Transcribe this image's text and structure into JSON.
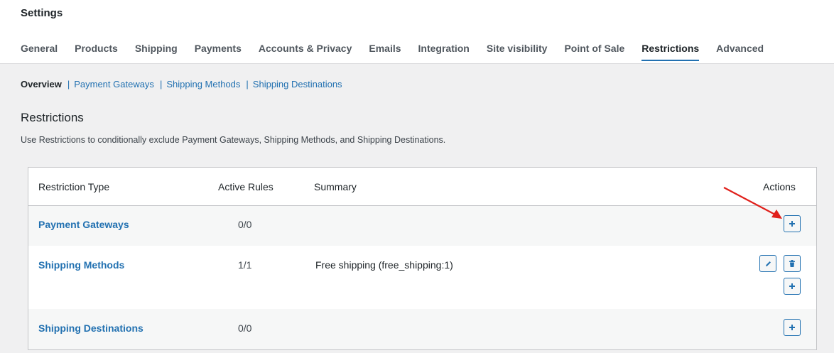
{
  "header": {
    "title": "Settings"
  },
  "tabs": [
    {
      "label": "General"
    },
    {
      "label": "Products"
    },
    {
      "label": "Shipping"
    },
    {
      "label": "Payments"
    },
    {
      "label": "Accounts & Privacy"
    },
    {
      "label": "Emails"
    },
    {
      "label": "Integration"
    },
    {
      "label": "Site visibility"
    },
    {
      "label": "Point of Sale"
    },
    {
      "label": "Restrictions",
      "active": true
    },
    {
      "label": "Advanced"
    }
  ],
  "subnav": {
    "current": "Overview",
    "separator": "|",
    "links": [
      "Payment Gateways",
      "Shipping Methods",
      "Shipping Destinations"
    ]
  },
  "section": {
    "heading": "Restrictions",
    "description": "Use Restrictions to conditionally exclude Payment Gateways, Shipping Methods, and Shipping Destinations."
  },
  "table": {
    "columns": {
      "type": "Restriction Type",
      "active": "Active Rules",
      "summary": "Summary",
      "actions": "Actions"
    },
    "rows": [
      {
        "type": "Payment Gateways",
        "active": "0/0",
        "summary": ""
      },
      {
        "type": "Shipping Methods",
        "active": "1/1",
        "summary": "Free shipping (free_shipping:1)"
      },
      {
        "type": "Shipping Destinations",
        "active": "0/0",
        "summary": ""
      }
    ]
  },
  "icons": {
    "add": "plus-icon",
    "edit": "pencil-icon",
    "delete": "trash-icon",
    "annotation": "red-arrow"
  },
  "colors": {
    "accent": "#2271b1",
    "annotation": "#e0201b"
  }
}
